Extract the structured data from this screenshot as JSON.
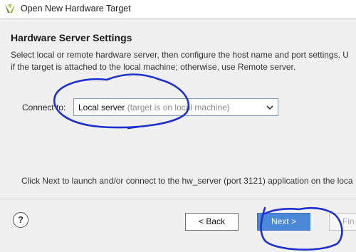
{
  "window": {
    "title": "Open New Hardware Target"
  },
  "section": {
    "heading": "Hardware Server Settings",
    "description_line1": "Select local or remote hardware server, then configure the host name and port settings. U",
    "description_line2": "if the target is attached to the local machine; otherwise, use Remote server."
  },
  "connect": {
    "label": "Connect to:",
    "selected_value": "Local server",
    "selected_hint": "(target is on local machine)"
  },
  "note": "Click Next to launch and/or connect to the hw_server (port 3121) application on the loca",
  "buttons": {
    "help": "?",
    "back": "< Back",
    "next": "Next >",
    "finish": "Fin"
  },
  "colors": {
    "accent": "#4a88d8",
    "annotation_ink": "#1e2fd0"
  }
}
